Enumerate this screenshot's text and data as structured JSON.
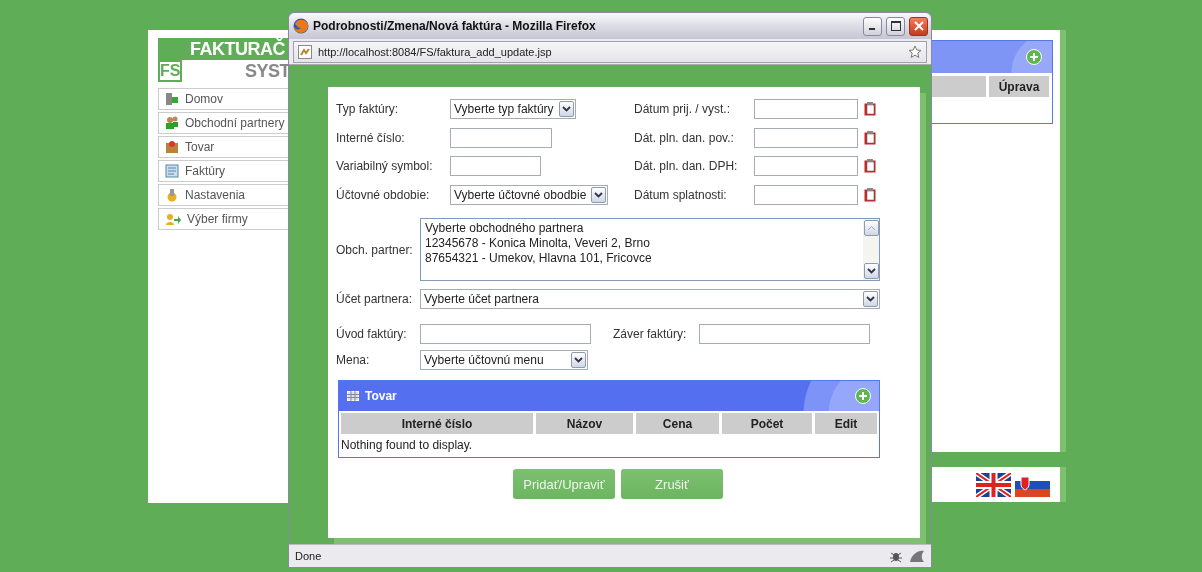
{
  "background_page": {
    "logo": {
      "mark": "FS",
      "line_1": "FAKTURAČ",
      "line_2": "SYST"
    },
    "menu": [
      {
        "label": "Domov",
        "kind": "home"
      },
      {
        "label": "Obchodní partnery",
        "kind": "partners"
      },
      {
        "label": "Tovar",
        "kind": "goods"
      },
      {
        "label": "Faktúry",
        "kind": "invoices"
      },
      {
        "label": "Nastavenia",
        "kind": "settings"
      },
      {
        "label": "Výber firmy",
        "kind": "company"
      }
    ],
    "grid": {
      "columns": [
        "Úprava"
      ]
    }
  },
  "window": {
    "title": "Podrobnosti/Zmena/Nová faktúra - Mozilla Firefox",
    "url": "http://localhost:8084/FS/faktura_add_update.jsp",
    "status": "Done"
  },
  "form": {
    "fields": [
      {
        "label": "Typ faktúry:",
        "kind": "select",
        "value": "Vyberte typ faktúry"
      },
      {
        "label": "Interné číslo:",
        "kind": "input"
      },
      {
        "label": "Variabilný symbol:",
        "kind": "input"
      },
      {
        "label": "Účtovné obdobie:",
        "kind": "select",
        "value": "Vyberte účtovné obodbie"
      }
    ],
    "date_fields": [
      {
        "label": "Dátum prij. / vyst.:"
      },
      {
        "label": "Dát. pln. dan. pov.:"
      },
      {
        "label": "Dát. pln. dan. DPH:"
      },
      {
        "label": "Dátum splatnosti:"
      }
    ],
    "partner": {
      "label": "Obch. partner:",
      "options": [
        "Vyberte obchodného partnera",
        "12345678 - Konica Minolta, Veveri 2, Brno",
        "87654321 - Umekov, Hlavna 101, Fricovce"
      ]
    },
    "account": {
      "label": "Účet partnera:",
      "value": "Vyberte účet partnera"
    },
    "intro": {
      "label": "Úvod faktúry:"
    },
    "outro": {
      "label": "Záver faktúry:"
    },
    "currency": {
      "label": "Mena:",
      "value": "Vyberte účtovnú menu"
    }
  },
  "goods_grid": {
    "title": "Tovar",
    "columns": [
      "Interné číslo",
      "Názov",
      "Cena",
      "Počet",
      "Edit"
    ],
    "empty_message": "Nothing found to display."
  },
  "buttons": [
    "Pridať/Upraviť",
    "Zrušiť"
  ]
}
